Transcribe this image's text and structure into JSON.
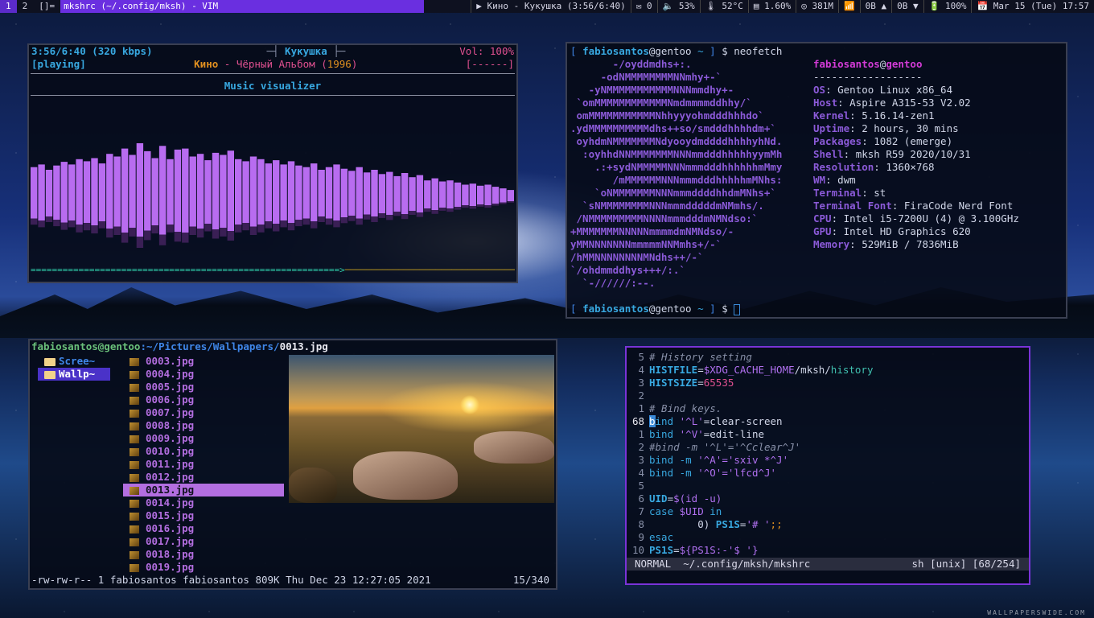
{
  "bar": {
    "workspaces": [
      "1",
      "2"
    ],
    "layout": "[]=",
    "window_title": "mkshrc (~/.config/mksh) - VIM",
    "status": [
      "▶ Кино - Кукушка (3:56/6:40)",
      "✉ 0",
      "🔈 53%",
      "🌡 52°C",
      "▤ 1.60%",
      "◎ 381M",
      "📶",
      "0B ▲",
      "0B ▼",
      "🔋 100%",
      "📅 Mar 15 (Tue) 17:57"
    ]
  },
  "music": {
    "time": "3:56/6:40 (320 kbps)",
    "song": "Кукушка",
    "vol": "Vol: 100%",
    "state": "[playing]",
    "artist": "Кино",
    "album": "Чёрный Альбом",
    "year": "1996",
    "flags": "[------]",
    "header": "Music visualizer",
    "bars": [
      0.55,
      0.6,
      0.5,
      0.58,
      0.65,
      0.6,
      0.7,
      0.66,
      0.72,
      0.62,
      0.8,
      0.75,
      0.9,
      0.78,
      1.0,
      0.85,
      0.72,
      0.95,
      0.7,
      0.88,
      0.9,
      0.75,
      0.8,
      0.68,
      0.82,
      0.78,
      0.86,
      0.7,
      0.66,
      0.75,
      0.7,
      0.62,
      0.68,
      0.6,
      0.66,
      0.58,
      0.55,
      0.62,
      0.5,
      0.55,
      0.6,
      0.52,
      0.48,
      0.55,
      0.45,
      0.5,
      0.42,
      0.46,
      0.38,
      0.44,
      0.36,
      0.4,
      0.3,
      0.34,
      0.28,
      0.3,
      0.26,
      0.22,
      0.24,
      0.2,
      0.22,
      0.18,
      0.15,
      0.12
    ]
  },
  "neofetch": {
    "prompt_user": "fabiosantos",
    "prompt_host": "gentoo",
    "command": "$ neofetch",
    "logo": [
      "       -/oyddmdhs+:.",
      "     -odNMMMMMMMMNNmhy+-`",
      "   -yNMMMMMMMMMMMNNNmmdhy+-",
      " `omMMMMMMMMMMMMNmdmmmmddhhy/`",
      " omMMMMMMMMMMMNhhyyyohmdddhhhdo`",
      ".ydMMMMMMMMMMdhs++so/smdddhhhhdm+`",
      " oyhdmNMMMMMMMNdyooydmddddhhhhyhNd.",
      "  :oyhhdNNMMMMMMMNNNmmdddhhhhhyymMh",
      "    .:+sydNMMMMMNNNmmmdddhhhhhhmMmy",
      "       /mMMMMMMNNNmmmdddhhhhhmMNhs:",
      "    `oNMMMMMMMNNNmmmddddhhdmMNhs+`",
      "  `sNMMMMMMMMNNNmmmdddddmNMmhs/.",
      " /NMMMMMMMMMNNNNmmmdddmNMNdso:`",
      "+MMMMMMMNNNNNmmmmdmNMNdso/-",
      "yMMNNNNNNNmmmmmNNMmhs+/-`",
      "/hMMNNNNNNNNMNdhs++/-`",
      "`/ohdmmddhys+++/:.`",
      "  `-//////:--."
    ],
    "userhost_user": "fabiosantos",
    "userhost_host": "gentoo",
    "separator": "------------------",
    "info": [
      {
        "k": "OS",
        "v": "Gentoo Linux x86_64"
      },
      {
        "k": "Host",
        "v": "Aspire A315-53 V2.02"
      },
      {
        "k": "Kernel",
        "v": "5.16.14-zen1"
      },
      {
        "k": "Uptime",
        "v": "2 hours, 30 mins"
      },
      {
        "k": "Packages",
        "v": "1082 (emerge)"
      },
      {
        "k": "Shell",
        "v": "mksh R59 2020/10/31"
      },
      {
        "k": "Resolution",
        "v": "1360×768"
      },
      {
        "k": "WM",
        "v": "dwm"
      },
      {
        "k": "Terminal",
        "v": "st"
      },
      {
        "k": "Terminal Font",
        "v": "FiraCode Nerd Font"
      },
      {
        "k": "CPU",
        "v": "Intel i5-7200U (4) @ 3.100GHz"
      },
      {
        "k": "GPU",
        "v": "Intel HD Graphics 620"
      },
      {
        "k": "Memory",
        "v": "529MiB / 7836MiB"
      }
    ],
    "prompt2": "$"
  },
  "lf": {
    "path_user": "fabiosantos@gentoo",
    "path_dir": ":~/Pictures/Wallpapers/",
    "path_file": "0013.jpg",
    "parents": [
      "Scree~",
      "Wallp~"
    ],
    "files": [
      "0003.jpg",
      "0004.jpg",
      "0005.jpg",
      "0006.jpg",
      "0007.jpg",
      "0008.jpg",
      "0009.jpg",
      "0010.jpg",
      "0011.jpg",
      "0012.jpg",
      "0013.jpg",
      "0014.jpg",
      "0015.jpg",
      "0016.jpg",
      "0017.jpg",
      "0018.jpg",
      "0019.jpg"
    ],
    "selected": "0013.jpg",
    "status_left": "-rw-rw-r-- 1 fabiosantos fabiosantos 809K Thu Dec 23 12:27:05 2021",
    "status_right": "15/340"
  },
  "vim": {
    "lines": [
      {
        "n": "5",
        "html": "<span class='grey' style='font-style:italic'># History setting</span>"
      },
      {
        "n": "4",
        "html": "<span class='cyan b'>HISTFILE</span>=<span class='purple'>$XDG_CACHE_HOME</span>/mksh/<span class='teal'>history</span>"
      },
      {
        "n": "3",
        "html": "<span class='cyan b'>HISTSIZE</span>=<span class='pink'>65535</span>"
      },
      {
        "n": "2",
        "html": ""
      },
      {
        "n": "1",
        "html": "<span class='grey' style='font-style:italic'># Bind keys.</span>"
      },
      {
        "n": "68",
        "cur": true,
        "html": "<span class='cursor'>b</span><span class='cyan'>ind</span> <span class='purple'>'^L'</span>=clear-screen"
      },
      {
        "n": "1",
        "html": "<span class='cyan'>bind</span> <span class='purple'>'^V'</span>=edit-line"
      },
      {
        "n": "2",
        "html": "<span class='grey' style='font-style:italic'>#bind -m '^L'='^Cclear^J'</span>"
      },
      {
        "n": "3",
        "html": "<span class='cyan'>bind -m</span> <span class='purple'>'^A'='sxiv *^J'</span>"
      },
      {
        "n": "4",
        "html": "<span class='cyan'>bind -m</span> <span class='purple'>'^O'='lfcd^J'</span>"
      },
      {
        "n": "5",
        "html": ""
      },
      {
        "n": "6",
        "html": "<span class='cyan b'>UID</span>=<span class='purple'>$(id -u)</span>"
      },
      {
        "n": "7",
        "html": "<span class='cyan'>case</span> <span class='purple'>$UID</span> <span class='cyan'>in</span>"
      },
      {
        "n": "8",
        "html": "        0) <span class='cyan b'>PS1S</span>=<span class='purple'>'# '</span><span class='orange'>;;</span>"
      },
      {
        "n": "9",
        "html": "<span class='cyan'>esac</span>"
      },
      {
        "n": "10",
        "html": "<span class='cyan b'>PS1S</span>=<span class='purple'>${PS1S:-'$ '}</span>"
      }
    ],
    "mode": "NORMAL",
    "file": "~/.config/mksh/mkshrc",
    "right": "sh [unix] [68/254]"
  },
  "watermark": "WALLPAPERSWIDE.COM",
  "colors": {
    "accent": "#7a33d8",
    "bars": "#b86cf0",
    "progress": "#2fc9a8"
  }
}
